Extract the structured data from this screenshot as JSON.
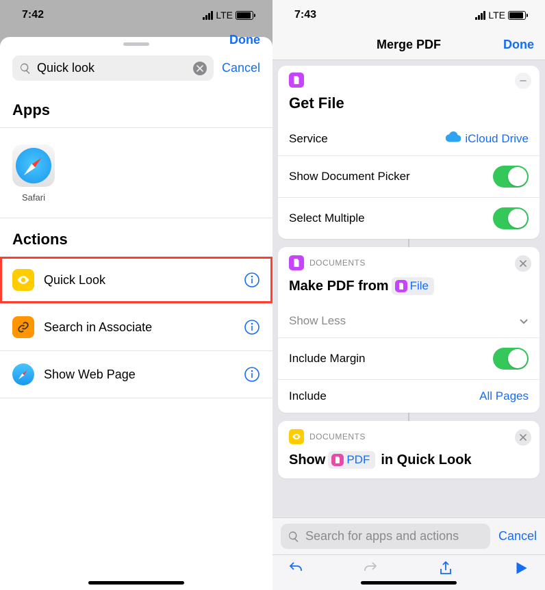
{
  "left": {
    "status_time": "7:42",
    "network": "LTE",
    "sheet_done": "Done",
    "search_value": "Quick look",
    "cancel": "Cancel",
    "apps_header": "Apps",
    "apps": [
      {
        "id": "safari",
        "label": "Safari"
      }
    ],
    "actions_header": "Actions",
    "actions": [
      {
        "id": "quick-look",
        "label": "Quick Look",
        "icon": "eye",
        "color": "#ffcc00",
        "highlight": true
      },
      {
        "id": "search-associate",
        "label": "Search in Associate",
        "icon": "link",
        "color": "#ff9500",
        "highlight": false
      },
      {
        "id": "show-web-page",
        "label": "Show Web Page",
        "icon": "safari",
        "color": "#ffffff",
        "highlight": false
      }
    ]
  },
  "right": {
    "status_time": "7:43",
    "network": "LTE",
    "nav_title": "Merge PDF",
    "nav_done": "Done",
    "card1": {
      "title": "Get File",
      "rows": {
        "service_label": "Service",
        "service_value": "iCloud Drive",
        "picker_label": "Show Document Picker",
        "multiple_label": "Select Multiple"
      }
    },
    "card2": {
      "category": "DOCUMENTS",
      "title_pre": "Make PDF from",
      "title_token": "File",
      "show_less": "Show Less",
      "margin_label": "Include Margin",
      "include_label": "Include",
      "include_value": "All Pages"
    },
    "card3": {
      "category": "DOCUMENTS",
      "title_pre": "Show",
      "title_token": "PDF",
      "title_post": "in Quick Look"
    },
    "search_placeholder": "Search for apps and actions",
    "cancel": "Cancel"
  }
}
